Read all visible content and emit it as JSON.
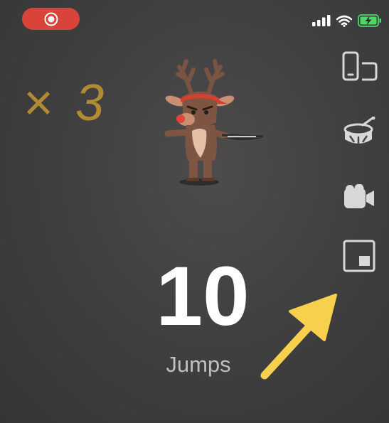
{
  "recording": {
    "icon": "record-icon",
    "color": "#d8433a"
  },
  "status_bar": {
    "icons": [
      "signal-icon",
      "wifi-icon",
      "battery-charging-icon"
    ],
    "battery_color": "#4cd964"
  },
  "game": {
    "multiplier": "× 3",
    "multiplier_color": "#b08b34",
    "count": "10",
    "count_label": "Jumps",
    "character": "reindeer-icon"
  },
  "side_toolbar": {
    "items": [
      {
        "icon": "device-rotate-icon"
      },
      {
        "icon": "drum-icon"
      },
      {
        "icon": "video-camera-icon"
      },
      {
        "icon": "picture-in-picture-icon"
      }
    ]
  },
  "annotation": {
    "icon": "pointer-arrow-icon",
    "color": "#f7d04d"
  }
}
